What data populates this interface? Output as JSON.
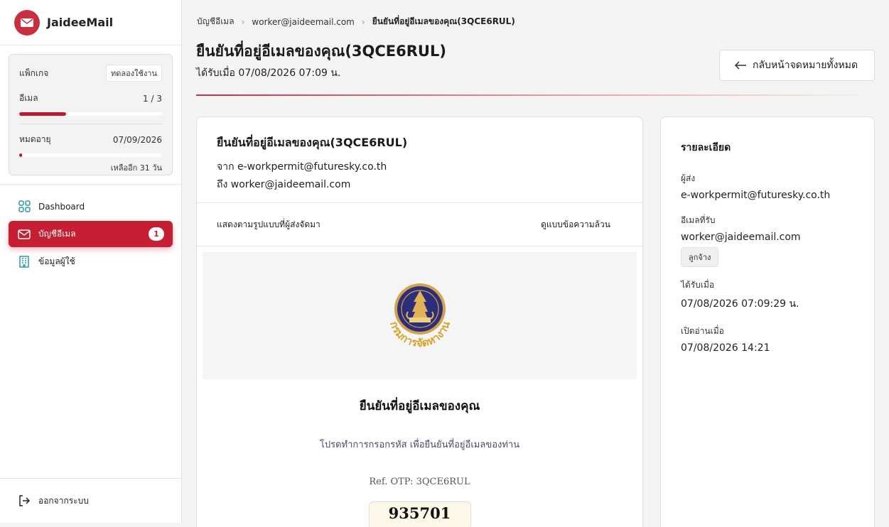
{
  "app": {
    "name": "JaideeMail"
  },
  "package": {
    "label": "แพ็กเกจ",
    "badge": "ทดลองใช้งาน",
    "email_label": "อีเมล",
    "email_count": "1 / 3",
    "email_fraction": 0.33,
    "expiry_label": "หมดอายุ",
    "expiry_date": "07/09/2026",
    "expiry_fraction": 0.02,
    "remaining": "เหลืออีก 31 วัน"
  },
  "nav": {
    "dashboard": "Dashboard",
    "mail_accounts": "บัญชีอีเมล",
    "mail_accounts_count": "1",
    "user_info": "ข้อมูลผู้ใช้",
    "logout": "ออกจากระบบ"
  },
  "breadcrumb": {
    "items": [
      "บัญชีอีเมล",
      "worker@jaideemail.com",
      "ยืนยันที่อยู่อีเมลของคุณ(3QCE6RUL)"
    ]
  },
  "header": {
    "title": "ยืนยันที่อยู่อีเมลของคุณ(3QCE6RUL)",
    "received": "ได้รับเมื่อ 07/08/2026 07:09 น.",
    "back_button": "กลับหน้าจดหมายทั้งหมด"
  },
  "mail": {
    "subject": "ยืนยันที่อยู่อีเมลของคุณ(3QCE6RUL)",
    "from_line": "จาก e-workpermit@futuresky.co.th",
    "to_line": "ถึง worker@jaideemail.com",
    "view_formatted": "แสดงตามรูปแบบที่ผู้ส่งจัดมา",
    "view_plain": "ดูแบบข้อความล้วน",
    "logo_text": "กรมการจัดหางาน",
    "body_heading": "ยืนยันที่อยู่อีเมลของคุณ",
    "body_text": "โปรดทำการกรอกรหัส เพื่อยืนยันที่อยู่อีเมลของท่าน",
    "ref_otp": "Ref. OTP: 3QCE6RUL",
    "otp": "935701"
  },
  "details": {
    "title": "รายละเอียด",
    "sender_label": "ผู้ส่ง",
    "sender": "e-workpermit@futuresky.co.th",
    "recipient_label": "อีเมลที่รับ",
    "recipient": "worker@jaideemail.com",
    "recipient_tag": "ลูกจ้าง",
    "received_label": "ได้รับเมื่อ",
    "received": "07/08/2026 07:09:29 น.",
    "opened_label": "เปิดอ่านเมื่อ",
    "opened": "07/08/2026 14:21"
  },
  "colors": {
    "brand": "#c61e33",
    "accent": "#c8303f"
  }
}
